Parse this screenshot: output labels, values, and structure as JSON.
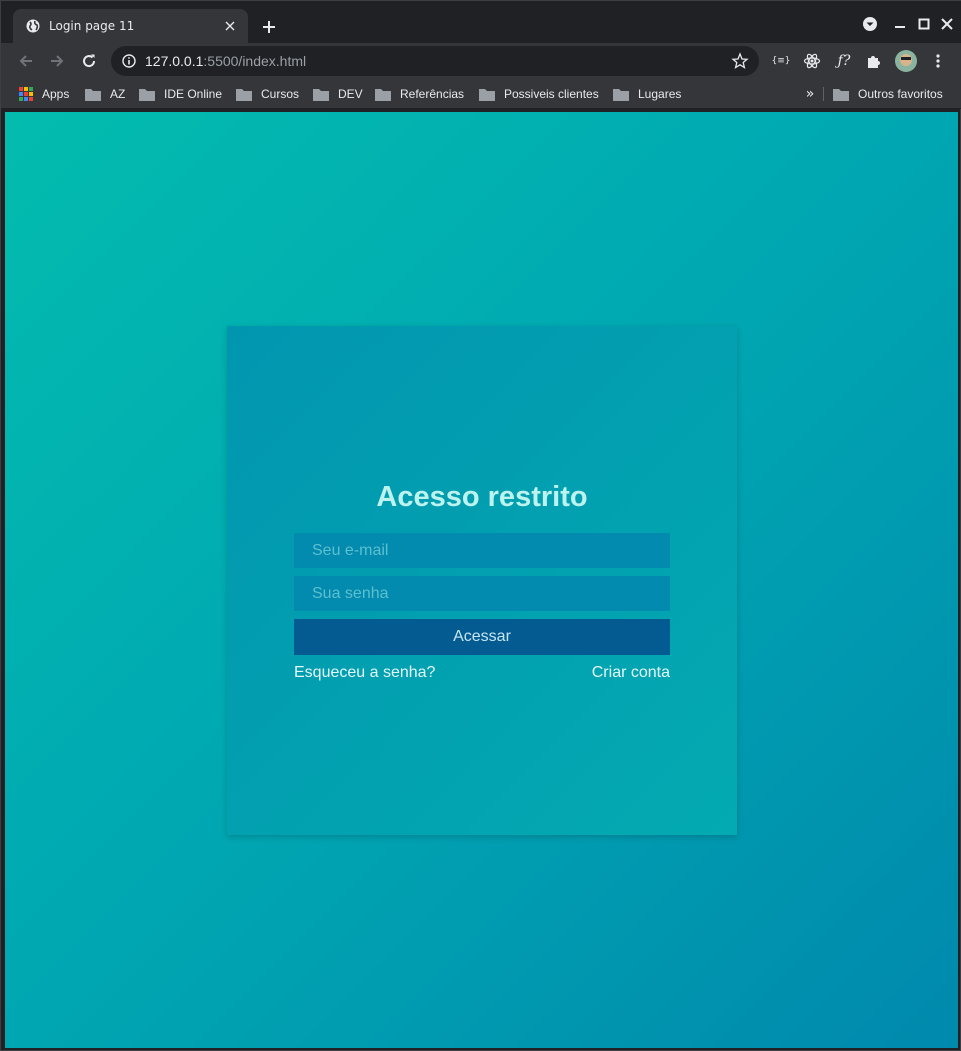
{
  "browser": {
    "tab_title": "Login page 11",
    "url_host": "127.0.0.1",
    "url_rest": ":5500/index.html",
    "extension_labels": [
      "{≡}",
      "ƒ?"
    ]
  },
  "bookmarks": {
    "items": [
      "Apps",
      "AZ",
      "IDE Online",
      "Cursos",
      "DEV",
      "Referências",
      "Possiveis clientes",
      "Lugares"
    ],
    "overflow": "»",
    "other": "Outros favoritos"
  },
  "login": {
    "title": "Acesso restrito",
    "email_placeholder": "Seu e-mail",
    "password_placeholder": "Sua senha",
    "submit_label": "Acessar",
    "forgot_link": "Esqueceu a senha?",
    "signup_link": "Criar conta"
  },
  "colors": {
    "gradient_start": "#03bcae",
    "gradient_end": "#0089ad",
    "button": "#035b92",
    "title": "#bdf3ee"
  }
}
